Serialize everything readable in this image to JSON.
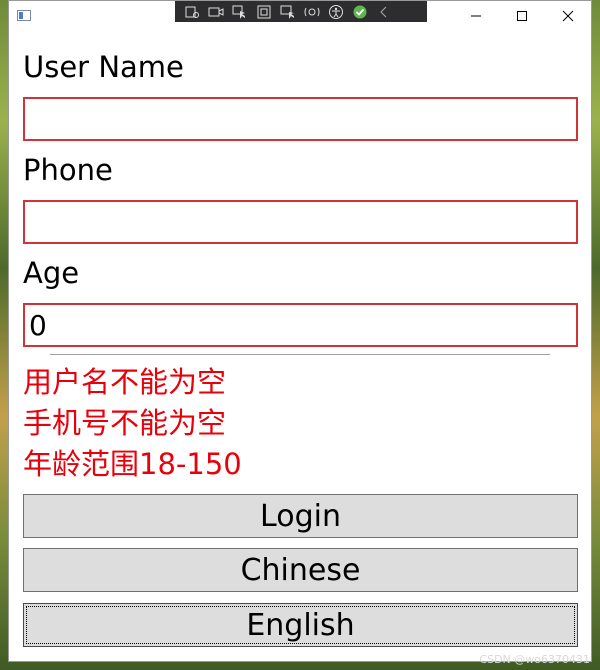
{
  "form": {
    "username_label": "User Name",
    "username_value": "",
    "phone_label": "Phone",
    "phone_value": "",
    "age_label": "Age",
    "age_value": "0"
  },
  "errors": [
    "用户名不能为空",
    "手机号不能为空",
    "年龄范围18-150"
  ],
  "buttons": {
    "login": "Login",
    "chinese": "Chinese",
    "english": "English"
  },
  "colors": {
    "error_border": "#d13438",
    "error_text": "#e8000a",
    "button_bg": "#dddddd"
  },
  "watermark": "CSDN @wo6370431"
}
